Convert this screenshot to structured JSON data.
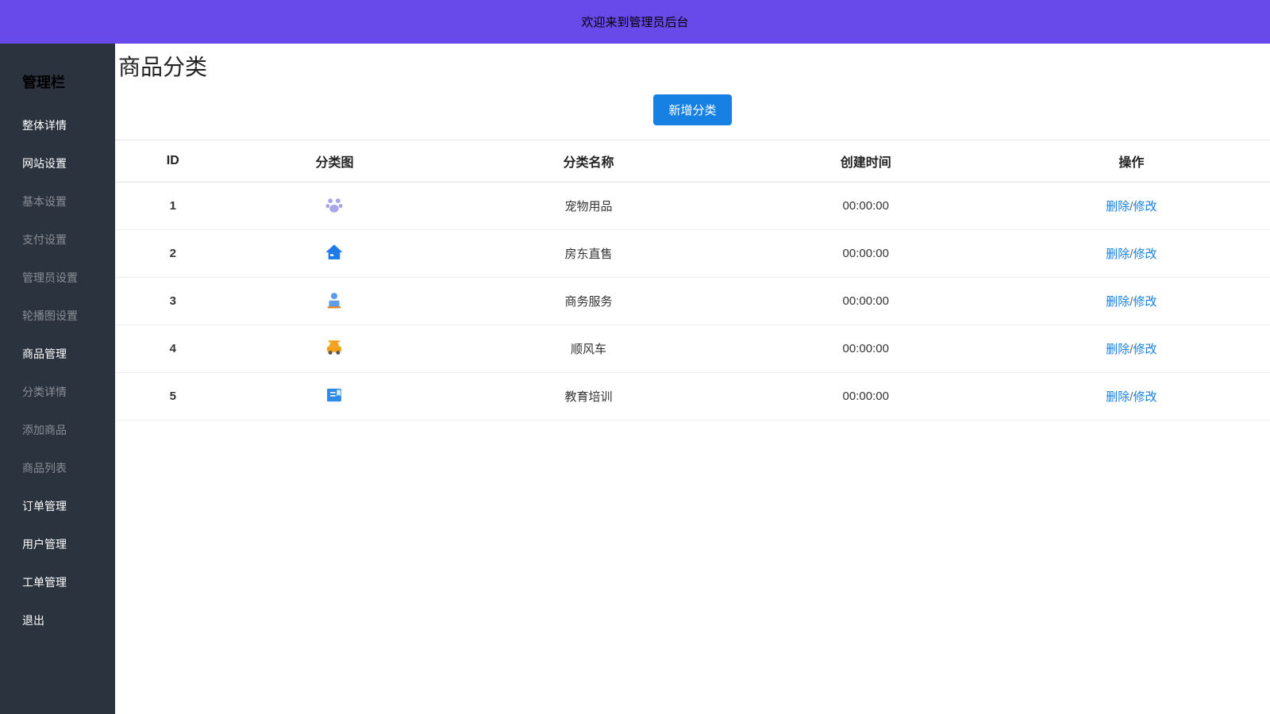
{
  "header": {
    "welcome": "欢迎来到管理员后台"
  },
  "sidebar": {
    "title": "管理栏",
    "items": [
      {
        "label": "整体详情",
        "tone": "white"
      },
      {
        "label": "网站设置",
        "tone": "white"
      },
      {
        "label": "基本设置",
        "tone": "grey"
      },
      {
        "label": "支付设置",
        "tone": "grey"
      },
      {
        "label": "管理员设置",
        "tone": "grey"
      },
      {
        "label": "轮播图设置",
        "tone": "grey"
      },
      {
        "label": "商品管理",
        "tone": "white"
      },
      {
        "label": "分类详情",
        "tone": "grey"
      },
      {
        "label": "添加商品",
        "tone": "grey"
      },
      {
        "label": "商品列表",
        "tone": "grey"
      },
      {
        "label": "订单管理",
        "tone": "white"
      },
      {
        "label": "用户管理",
        "tone": "white"
      },
      {
        "label": "工单管理",
        "tone": "white"
      },
      {
        "label": "退出",
        "tone": "white"
      }
    ]
  },
  "main": {
    "title": "商品分类",
    "add_button": "新增分类",
    "columns": {
      "id": "ID",
      "icon": "分类图",
      "name": "分类名称",
      "created": "创建时间",
      "actions": "操作"
    },
    "action_labels": {
      "delete": "删除",
      "edit": "修改"
    },
    "rows": [
      {
        "id": "1",
        "icon": "pet",
        "name": "宠物用品",
        "created": "00:00:00"
      },
      {
        "id": "2",
        "icon": "house",
        "name": "房东直售",
        "created": "00:00:00"
      },
      {
        "id": "3",
        "icon": "business",
        "name": "商务服务",
        "created": "00:00:00"
      },
      {
        "id": "4",
        "icon": "car",
        "name": "顺风车",
        "created": "00:00:00"
      },
      {
        "id": "5",
        "icon": "education",
        "name": "教育培训",
        "created": "00:00:00"
      }
    ]
  },
  "icon_colors": {
    "pet": "#a9a3e8",
    "house": "#1f7be8",
    "business": "#5a9de8",
    "car": "#f2a21d",
    "education": "#2d8ae6"
  }
}
